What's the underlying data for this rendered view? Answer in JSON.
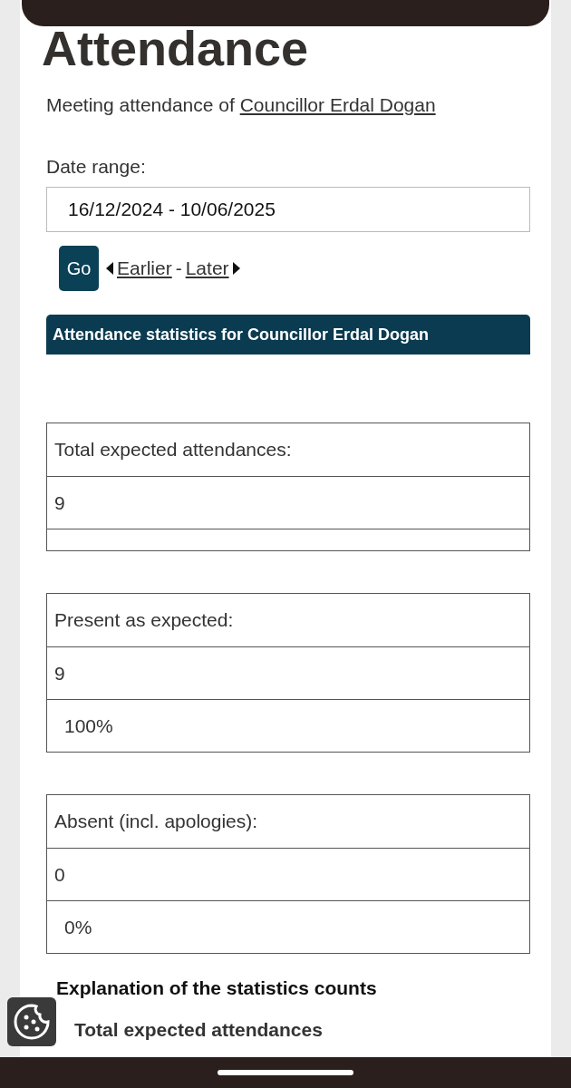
{
  "page_title": "Attendance",
  "intro": {
    "text": "Meeting attendance of",
    "link": "Councillor Erdal Dogan"
  },
  "date_range": {
    "label": "Date range:",
    "value": "16/12/2024 - 10/06/2025"
  },
  "go_button": "Go",
  "nav": {
    "earlier": "Earlier",
    "separator": "-",
    "later": "Later"
  },
  "stats_heading": "Attendance statistics for Councillor Erdal Dogan",
  "stats": [
    {
      "label": "Total expected attendances:",
      "count": "9"
    },
    {
      "label": "Present as expected:",
      "count": "9",
      "percent": "100%"
    },
    {
      "label": "Absent (incl. apologies):",
      "count": "0",
      "percent": "0%"
    }
  ],
  "explanation": {
    "title": "Explanation of the statistics counts",
    "subtitle": "Total expected attendances"
  }
}
